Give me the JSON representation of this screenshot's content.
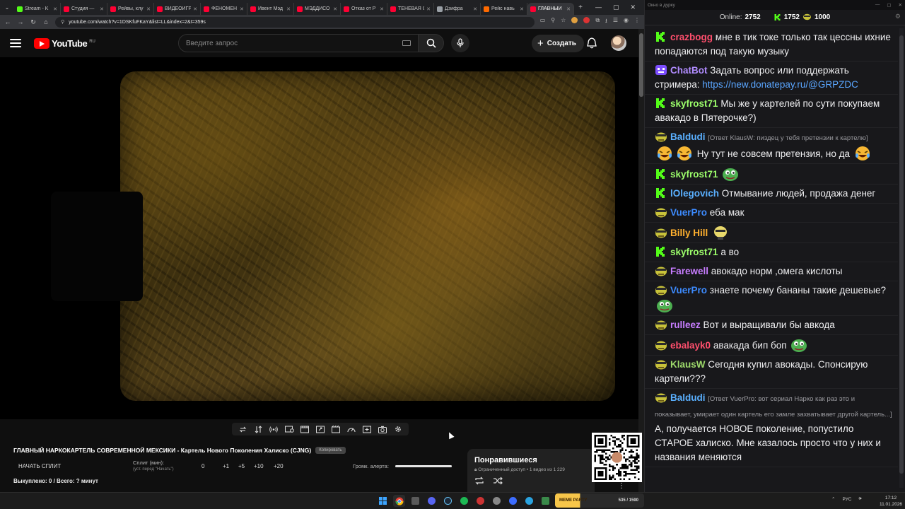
{
  "browser": {
    "tabs": [
      {
        "title": "Stream - K",
        "color": "#53fc18",
        "active": false
      },
      {
        "title": "Студия — ",
        "color": "#ff0033",
        "active": false
      },
      {
        "title": "Рейвы, клу",
        "color": "#ff0033",
        "active": false
      },
      {
        "title": "ВИДЕОИГРЫ",
        "color": "#ff0033",
        "active": false
      },
      {
        "title": "ФЕНОМЕН ",
        "color": "#ff0033",
        "active": false
      },
      {
        "title": "Ивент Мэд",
        "color": "#ff0033",
        "active": false
      },
      {
        "title": "МЭДДИСО",
        "color": "#ff0033",
        "active": false
      },
      {
        "title": "Отказ от Р",
        "color": "#ff0033",
        "active": false
      },
      {
        "title": "ТЕНЕВАЯ С",
        "color": "#ff0033",
        "active": false
      },
      {
        "title": "Дзифра",
        "color": "#9aa0a6",
        "active": false
      },
      {
        "title": "Рейс навь",
        "color": "#ff6a00",
        "active": false
      },
      {
        "title": "ГЛАВНЫЙ",
        "color": "#ff0033",
        "active": true
      }
    ],
    "url": "youtube.com/watch?v=1DSKfuFKaY&list=LL&index=2&t=359s"
  },
  "youtube": {
    "logo_text": "YouTube",
    "region": "RU",
    "search_placeholder": "Введите запрос",
    "create_label": "Создать"
  },
  "below_player": {
    "video_title": "ГЛАВНЫЙ НАРКОКАРТЕЛЬ СОВРЕМЕННОЙ МЕКСИКИ - Картель Нового Поколения Халиско (CJNG)",
    "copy_chip": "Копировать",
    "split_button": "НАЧАТЬ СПЛИТ",
    "split_label": "Сплит (мин):",
    "split_hint": "(уст. перед \"Начать\")",
    "split_value": "0",
    "split_increments": [
      "+1",
      "+5",
      "+10",
      "+20"
    ],
    "alert_label": "Громк. алерта:",
    "alert_volume": 1.0,
    "bought_text": "Выкуплено: 0 / Всего: ? минут"
  },
  "liked": {
    "title": "Понравившиеся",
    "subtitle": "Ограниченный доступ",
    "count": "1 видео из 1 229"
  },
  "chat": {
    "window_title": "Окно в дурку",
    "online_label": "Online:",
    "online_count": "2752",
    "kick_count": "1752",
    "other_count": "1000",
    "messages": [
      {
        "badge": "kick",
        "nick": "crazbogg",
        "color": "#ff4f6d",
        "text": "мне в тик токе только так цессны ихние попадаются под такую музыку"
      },
      {
        "badge": "bot",
        "nick": "ChatBot",
        "color": "#b18cff",
        "text": "Задать вопрос или поддержать стримера: ",
        "link": "https://new.donatepay.ru/@GRPZDC"
      },
      {
        "badge": "kick",
        "nick": "skyfrost71",
        "color": "#9dff6b",
        "text": "Мы же у картелей по сути покупаем авакадо в Пятерочке?)"
      },
      {
        "badge": "pepe",
        "nick": "Baldudi",
        "color": "#5ab0ff",
        "reply": "[Ответ KlausW: пиздец у тебя претензии к картелю]",
        "text": "Ну тут не совсем претензия, но да",
        "emotes": [
          "laugh",
          "laugh",
          "laugh"
        ]
      },
      {
        "badge": "kick",
        "nick": "skyfrost71",
        "color": "#9dff6b",
        "text": "",
        "emotes": [
          "pepe"
        ]
      },
      {
        "badge": "kick",
        "nick": "lOlegovich",
        "color": "#5ab0ff",
        "text": "Отмывание людей, продажа денег"
      },
      {
        "badge": "pepe",
        "nick": "VuerPro",
        "color": "#3d8bff",
        "text": "еба мак"
      },
      {
        "badge": "pepe",
        "nick": "Billy Hill",
        "color": "#ffb02e",
        "text": "",
        "emotes": [
          "face"
        ]
      },
      {
        "badge": "kick",
        "nick": "skyfrost71",
        "color": "#9dff6b",
        "text": "а во"
      },
      {
        "badge": "pepe",
        "nick": "Farewell",
        "color": "#c77dff",
        "text": "авокадо норм ,омега кислоты"
      },
      {
        "badge": "pepe",
        "nick": "VuerPro",
        "color": "#3d8bff",
        "text": "знаете почему бананы такие дешевые?",
        "emotes": [
          "pepe"
        ]
      },
      {
        "badge": "pepe",
        "nick": "rulleez",
        "color": "#c77dff",
        "text": "Вот и выращивали бы авкода"
      },
      {
        "badge": "pepe",
        "nick": "ebalayk0",
        "color": "#ff4f6d",
        "text": "авакада бип боп",
        "emotes": [
          "pepe"
        ]
      },
      {
        "badge": "pepe",
        "nick": "KlausW",
        "color": "#9dd96b",
        "text": "Сегодня купил авокады. Спонсирую картели???"
      },
      {
        "badge": "pepe",
        "nick": "Baldudi",
        "color": "#5ab0ff",
        "reply": "[Ответ VuerPro: вот сериал Нарко как раз это и показывает, умирает один картель его замле захватывает другой картель...]",
        "text": "А, получается НОВОЕ поколение, попустило СТАРОЕ халиско. Мне казалось просто что у них и названия меняются"
      }
    ]
  },
  "taskbar": {
    "widget_label": "MEME PARTY",
    "widget_count": "535 / 1590",
    "lang": "РУС",
    "time": "17:12",
    "date": "11.01.2026"
  }
}
